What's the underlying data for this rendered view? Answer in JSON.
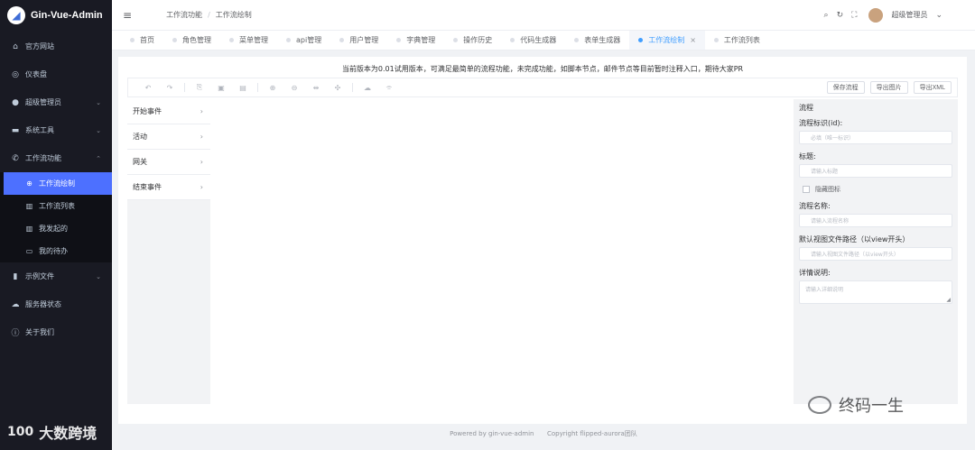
{
  "app": {
    "title": "Gin-Vue-Admin",
    "logo_glyph": "◢"
  },
  "sidebar": {
    "items": [
      {
        "label": "官方网站",
        "icon": "home-icon",
        "glyph": "⌂"
      },
      {
        "label": "仪表盘",
        "icon": "dashboard-icon",
        "glyph": "◎"
      },
      {
        "label": "超级管理员",
        "icon": "user-icon",
        "glyph": "●",
        "arrow": "⌄"
      },
      {
        "label": "系统工具",
        "icon": "toolbox-icon",
        "glyph": "▬",
        "arrow": "⌄"
      },
      {
        "label": "工作流功能",
        "icon": "phone-icon",
        "glyph": "✆",
        "arrow": "⌃"
      }
    ],
    "sub_items": [
      {
        "label": "工作流绘制",
        "icon": "plus-circle-icon",
        "glyph": "⊕"
      },
      {
        "label": "工作流列表",
        "icon": "bank-icon",
        "glyph": "▥"
      },
      {
        "label": "我发起的",
        "icon": "bank-icon",
        "glyph": "▥"
      },
      {
        "label": "我的待办",
        "icon": "monitor-icon",
        "glyph": "▭"
      }
    ],
    "bottom_items": [
      {
        "label": "示例文件",
        "icon": "chart-icon",
        "glyph": "▮",
        "arrow": "⌄"
      },
      {
        "label": "服务器状态",
        "icon": "cloud-icon",
        "glyph": "☁"
      },
      {
        "label": "关于我们",
        "icon": "info-icon",
        "glyph": "ⓘ"
      }
    ],
    "watermark": {
      "glyph": "100",
      "text": "大数跨境"
    }
  },
  "header": {
    "hamburger_glyph": "≡",
    "breadcrumb": [
      "工作流功能",
      "工作流绘制"
    ],
    "breadcrumb_sep": "/",
    "icons": {
      "search": "⌕",
      "refresh": "↻",
      "fullscreen": "⛶"
    },
    "user": "超级管理员",
    "user_arrow": "⌄"
  },
  "tabs": [
    {
      "label": "首页",
      "active": false
    },
    {
      "label": "角色管理",
      "active": false
    },
    {
      "label": "菜单管理",
      "active": false
    },
    {
      "label": "api管理",
      "active": false
    },
    {
      "label": "用户管理",
      "active": false
    },
    {
      "label": "字典管理",
      "active": false
    },
    {
      "label": "操作历史",
      "active": false
    },
    {
      "label": "代码生成器",
      "active": false
    },
    {
      "label": "表单生成器",
      "active": false
    },
    {
      "label": "工作流绘制",
      "active": true,
      "close": "×"
    },
    {
      "label": "工作流列表",
      "active": false
    }
  ],
  "main": {
    "notice": "当前版本为0.01试用版本，可满足最简单的流程功能，未完成功能，如脚本节点，邮件节点等目前暂时注释入口，期待大家PR",
    "toolbar": {
      "tools": [
        {
          "name": "undo-icon",
          "glyph": "↶"
        },
        {
          "name": "redo-icon",
          "glyph": "↷"
        },
        {
          "name": "sep"
        },
        {
          "name": "copy-icon",
          "glyph": "⎘"
        },
        {
          "name": "paste-icon",
          "glyph": "▣"
        },
        {
          "name": "delete-icon",
          "glyph": "▤"
        },
        {
          "name": "sep"
        },
        {
          "name": "zoom-in-icon",
          "glyph": "⊕"
        },
        {
          "name": "zoom-out-icon",
          "glyph": "⊖"
        },
        {
          "name": "fit-icon",
          "glyph": "⇹"
        },
        {
          "name": "actual-size-icon",
          "glyph": "✣"
        },
        {
          "name": "sep"
        },
        {
          "name": "auto-layout-icon",
          "glyph": "☁"
        },
        {
          "name": "align-icon",
          "glyph": "⌯"
        }
      ],
      "save_label": "保存流程",
      "export_image_label": "导出图片",
      "export_xml_label": "导出XML"
    },
    "palette": [
      {
        "label": "开始事件",
        "chev": "›"
      },
      {
        "label": "活动",
        "chev": "›"
      },
      {
        "label": "网关",
        "chev": "›"
      },
      {
        "label": "结束事件",
        "chev": "›"
      }
    ],
    "panel": {
      "title": "流程",
      "id_label": "流程标识(id):",
      "id_placeholder": "必填（唯一标识）",
      "title_label": "标题:",
      "title_placeholder": "请输入标题",
      "hide_icon_label": "隐藏图标",
      "name_label": "流程名称:",
      "name_placeholder": "请输入流程名称",
      "view_label": "默认视图文件路径（以view开头）",
      "view_placeholder": "请输入视图文件路径（以view开头）",
      "desc_label": "详情说明:",
      "desc_placeholder": "请输入详细说明",
      "grip": "◢"
    }
  },
  "footer": {
    "powered": "Powered by gin-vue-admin",
    "copyright": "Copyright flipped-aurora团队"
  },
  "watermark_right": "终码一生"
}
